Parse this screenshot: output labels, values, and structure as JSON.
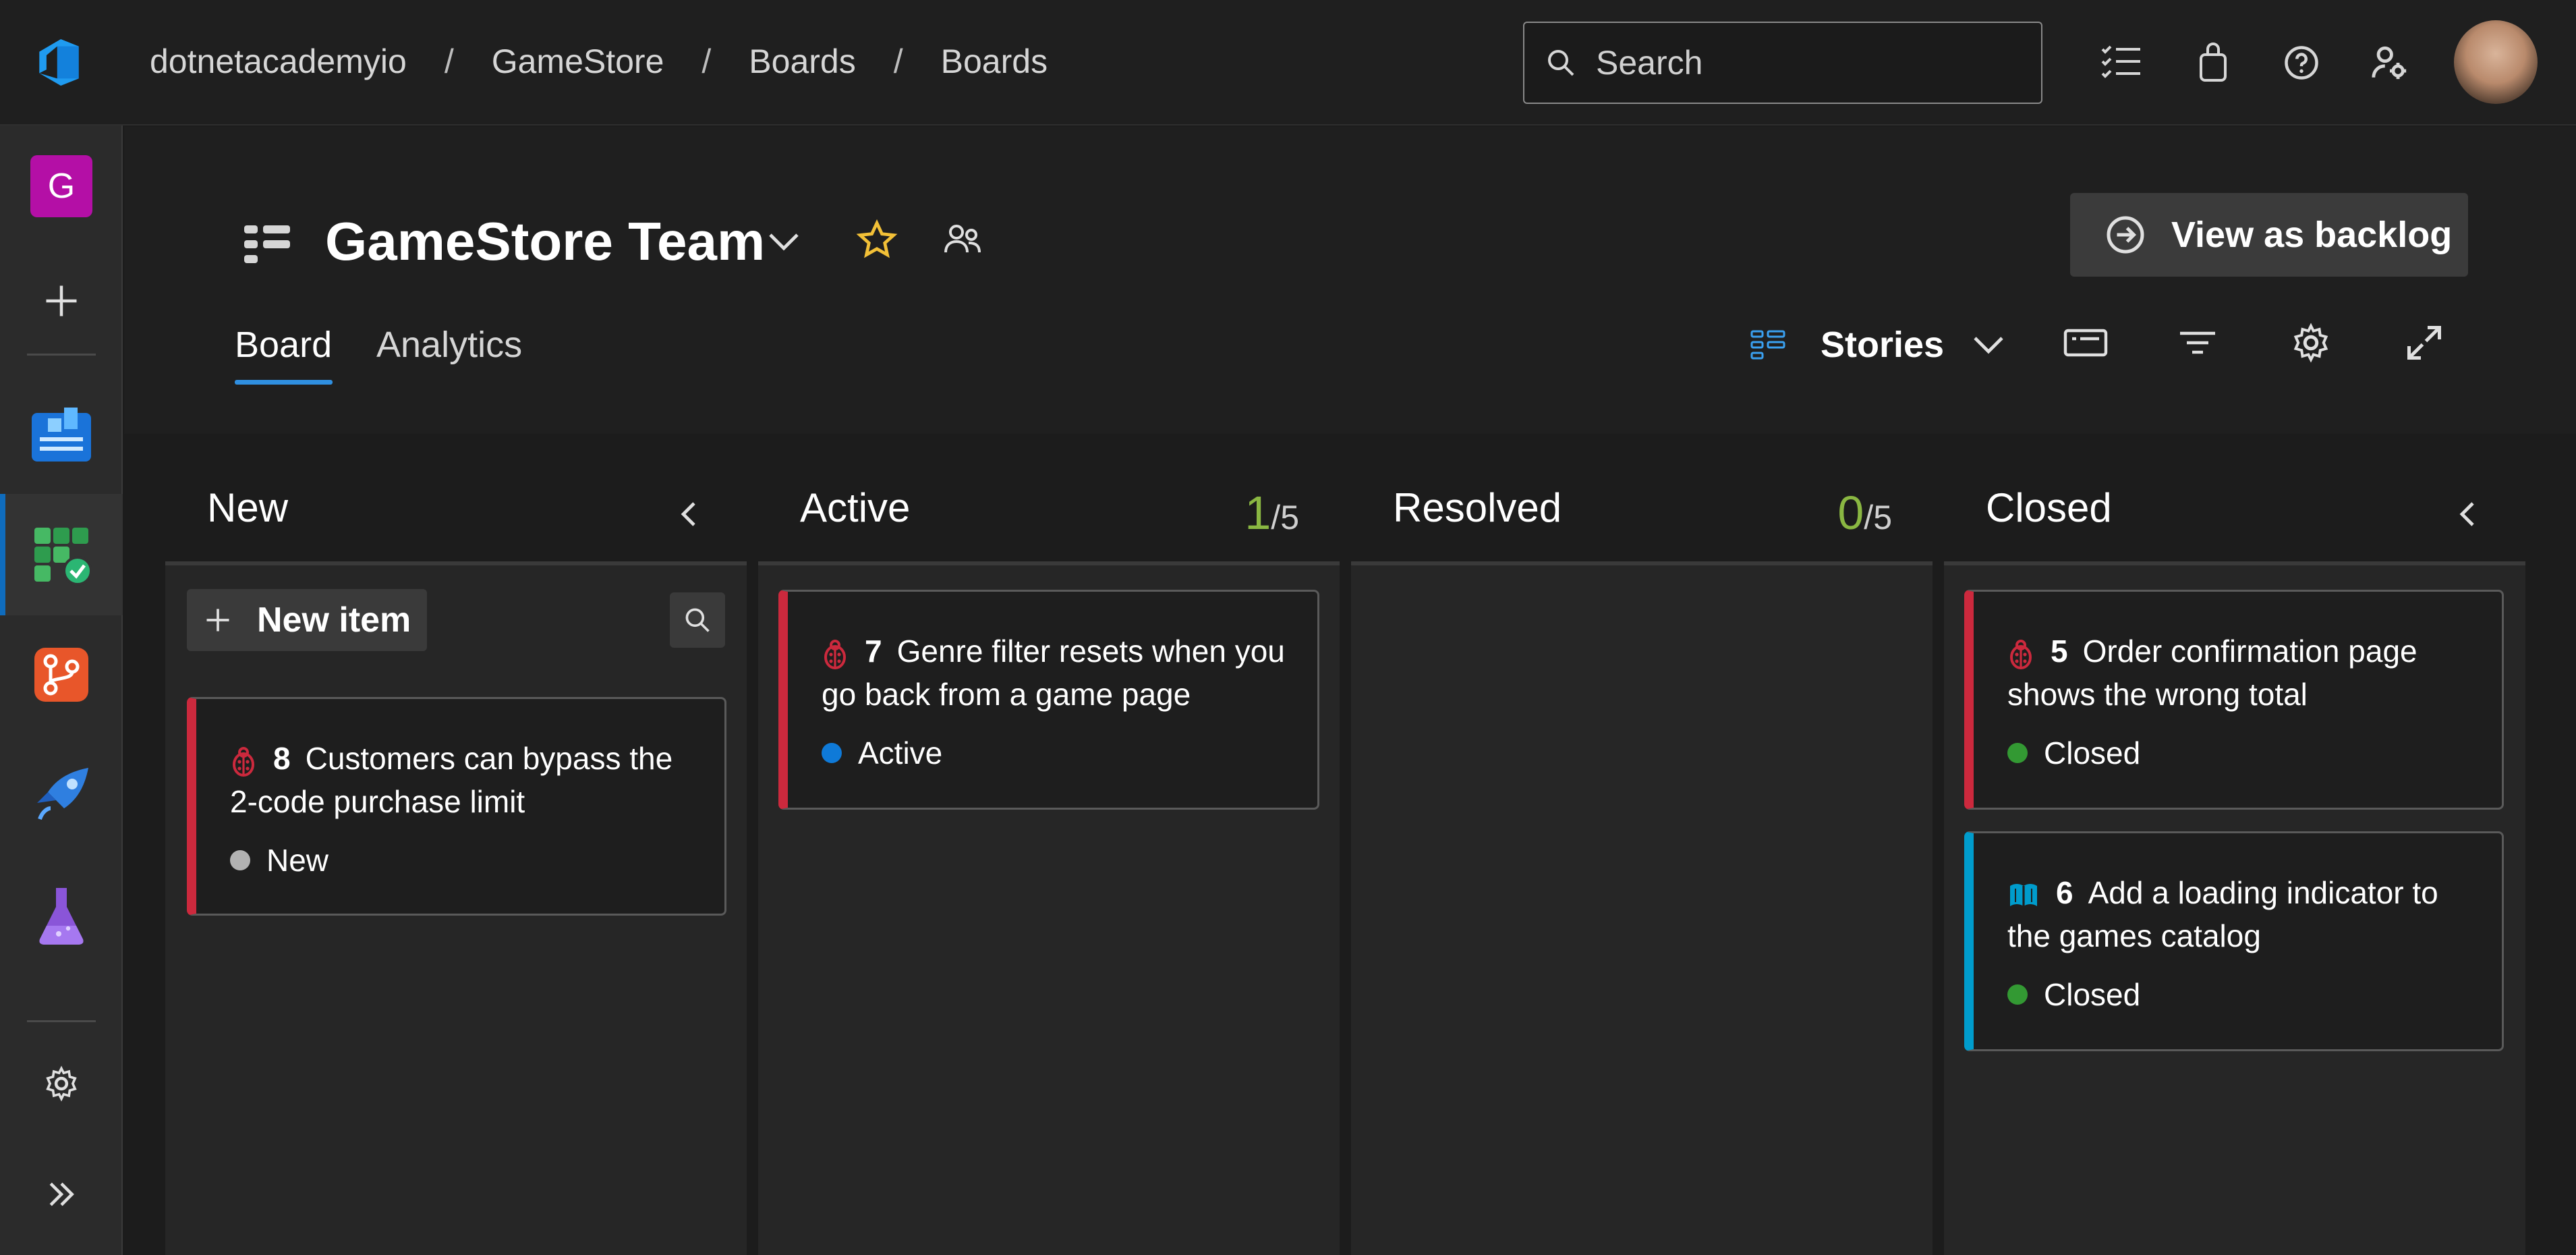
{
  "breadcrumb": [
    "dotnetacademyio",
    "GameStore",
    "Boards",
    "Boards"
  ],
  "search": {
    "placeholder": "Search"
  },
  "rail": {
    "project_initial": "G"
  },
  "team": {
    "name": "GameStore Team"
  },
  "actions": {
    "view_as_backlog": "View as backlog"
  },
  "tabs": {
    "board": "Board",
    "analytics": "Analytics"
  },
  "backlog_level": "Stories",
  "columns": [
    {
      "title": "New"
    },
    {
      "title": "Active",
      "count": "1",
      "limit": "/5"
    },
    {
      "title": "Resolved",
      "count": "0",
      "limit": "/5"
    },
    {
      "title": "Closed"
    }
  ],
  "new_item_label": "New item",
  "cards": [
    {
      "id": "8",
      "title": "Customers can bypass the 2-code purchase limit",
      "state": "New",
      "type": "bug"
    },
    {
      "id": "7",
      "title": "Genre filter resets when you go back from a game page",
      "state": "Active",
      "type": "bug"
    },
    {
      "id": "5",
      "title": "Order confirmation page shows the wrong total",
      "state": "Closed",
      "type": "bug"
    },
    {
      "id": "6",
      "title": "Add a loading indicator to the games catalog",
      "state": "Closed",
      "type": "story"
    }
  ],
  "colors": {
    "bug": "#cc293d",
    "story": "#009ccc",
    "state_new": "#b2b2b2",
    "state_active": "#0f7ad8",
    "state_closed": "#339933",
    "wip_count": "#8ab742",
    "accent": "#2f8fe0"
  }
}
